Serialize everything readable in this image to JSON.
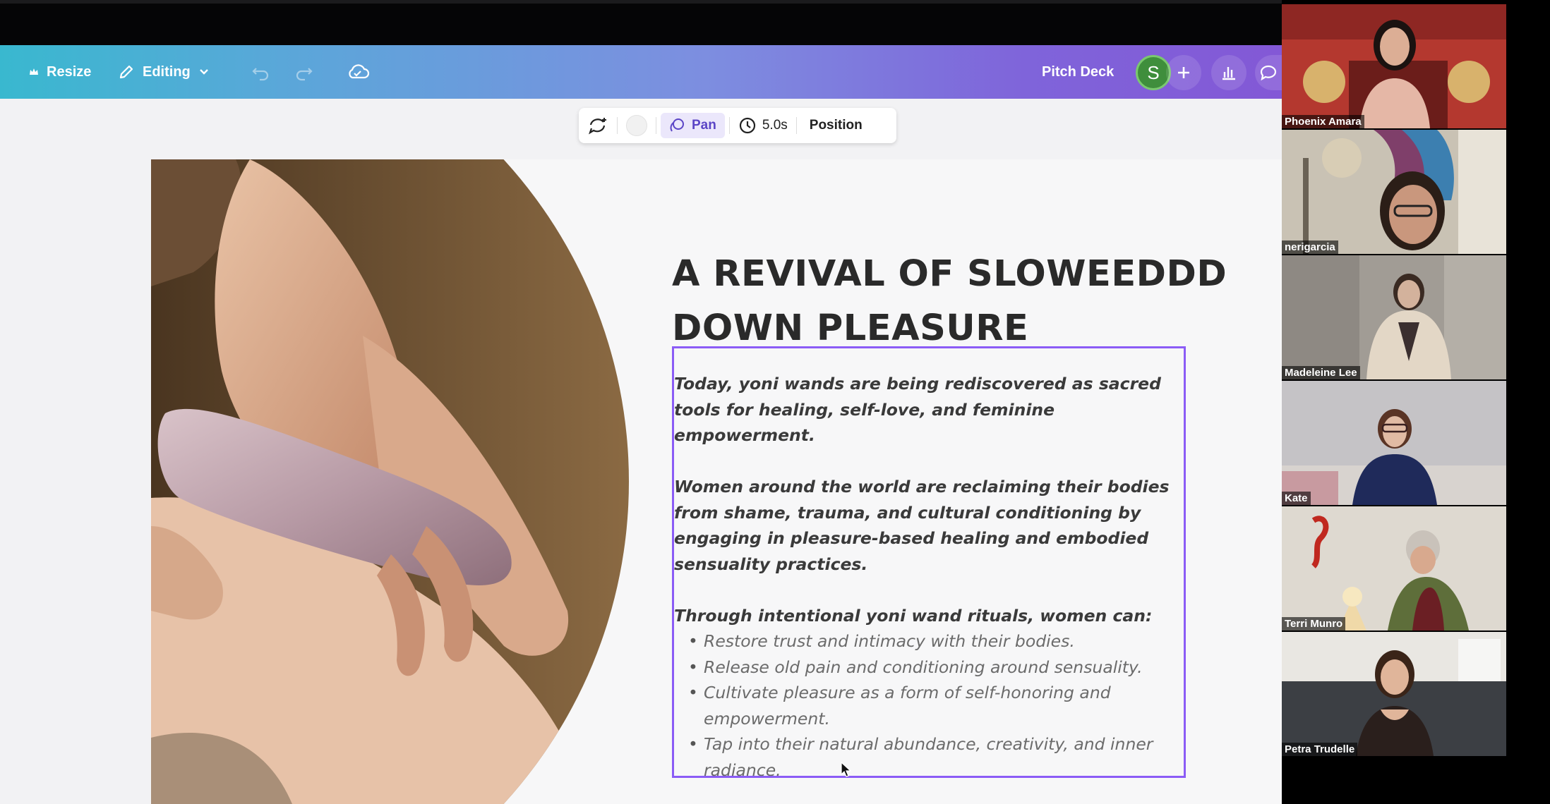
{
  "toolbar": {
    "resize_label": "Resize",
    "editing_label": "Editing",
    "doc_title": "Pitch Deck",
    "avatar_initial": "S"
  },
  "floating_bar": {
    "pan_label": "Pan",
    "duration": "5.0s",
    "position_label": "Position"
  },
  "slide": {
    "headline_line1": "A REVIVAL OF SLOWEEDDD",
    "headline_line2": "DOWN PLEASURE",
    "para1_line1": "Today, yoni wands are being rediscovered as sacred",
    "para1_line2": "tools for healing, self-love, and feminine empowerment.",
    "para2_line1": "Women around the world are reclaiming their bodies",
    "para2_line2": "from shame, trauma, and cultural conditioning by",
    "para2_line3": "engaging in pleasure-based healing and embodied",
    "para2_line4": "sensuality practices.",
    "list_intro": "Through intentional yoni wand rituals, women can:",
    "bullets": [
      {
        "line1": "Restore trust and intimacy with their bodies.",
        "line2": ""
      },
      {
        "line1": "Release old pain and conditioning around sensuality.",
        "line2": ""
      },
      {
        "line1": "Cultivate pleasure as a form of self-honoring and",
        "line2": "empowerment."
      },
      {
        "line1": "Tap into their natural abundance, creativity, and inner",
        "line2": "radiance."
      }
    ]
  },
  "participants": [
    {
      "name": "Phoenix Amara"
    },
    {
      "name": "nerigarcia"
    },
    {
      "name": "Madeleine Lee"
    },
    {
      "name": "Kate"
    },
    {
      "name": "Terri Munro"
    },
    {
      "name": "Petra Trudelle"
    }
  ],
  "colors": {
    "selection": "#8b5cf6",
    "accent": "#7f64da",
    "avatar": "#3f8e3c"
  }
}
